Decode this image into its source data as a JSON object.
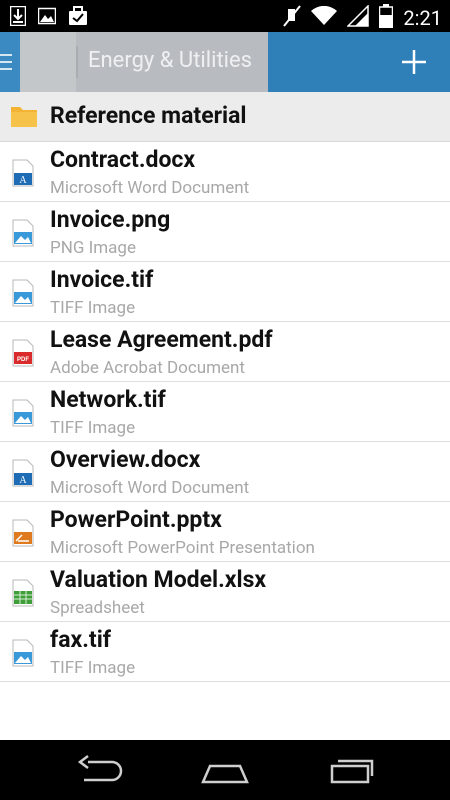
{
  "status_bar": {
    "time": "2:21",
    "left_icons": [
      "download-icon",
      "image-icon",
      "briefcase-check-icon"
    ],
    "right_icons": [
      "mute-icon",
      "wifi-icon",
      "signal-icon",
      "battery-icon"
    ]
  },
  "app_bar": {
    "title": "Energy & Utilities",
    "menu_icon": "menu-icon",
    "add_icon": "plus-icon",
    "color": "#2f7fb8"
  },
  "folder": {
    "name": "Reference material",
    "icon": "folder-icon"
  },
  "files": [
    {
      "name": "Contract.docx",
      "type": "Microsoft Word Document",
      "icon": "word-icon"
    },
    {
      "name": "Invoice.png",
      "type": "PNG Image",
      "icon": "image-file-icon"
    },
    {
      "name": "Invoice.tif",
      "type": "TIFF Image",
      "icon": "image-file-icon"
    },
    {
      "name": "Lease Agreement.pdf",
      "type": "Adobe Acrobat Document",
      "icon": "pdf-icon"
    },
    {
      "name": "Network.tif",
      "type": "TIFF Image",
      "icon": "image-file-icon"
    },
    {
      "name": "Overview.docx",
      "type": "Microsoft Word Document",
      "icon": "word-icon"
    },
    {
      "name": "PowerPoint.pptx",
      "type": "Microsoft PowerPoint Presentation",
      "icon": "powerpoint-icon"
    },
    {
      "name": "Valuation Model.xlsx",
      "type": "Spreadsheet",
      "icon": "spreadsheet-icon"
    },
    {
      "name": "fax.tif",
      "type": "TIFF Image",
      "icon": "image-file-icon"
    }
  ],
  "nav_bar": {
    "buttons": [
      "back-icon",
      "home-icon",
      "recent-apps-icon"
    ]
  }
}
